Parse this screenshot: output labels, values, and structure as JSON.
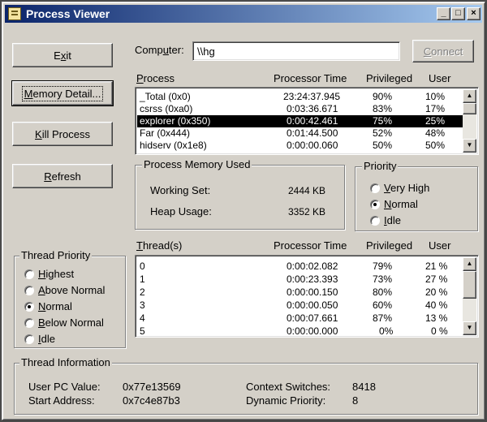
{
  "window": {
    "title": "Process Viewer"
  },
  "titlebar_buttons": {
    "minimize": "_",
    "maximize": "□",
    "close": "×"
  },
  "buttons": {
    "exit": {
      "pre": "E",
      "acc": "x",
      "post": "it"
    },
    "memory_detail": {
      "pre": "",
      "acc": "M",
      "post": "emory Detail..."
    },
    "kill_process": {
      "pre": "",
      "acc": "K",
      "post": "ill Process"
    },
    "refresh": {
      "pre": "",
      "acc": "R",
      "post": "efresh"
    },
    "connect": {
      "pre": "",
      "acc": "C",
      "post": "onnect"
    }
  },
  "computer": {
    "label_pre": "Comp",
    "label_acc": "u",
    "label_post": "ter:",
    "value": "\\\\hg"
  },
  "process_list": {
    "headers": {
      "process_acc": "P",
      "process_post": "rocess",
      "time": "Processor Time",
      "priv": "Privileged",
      "user": "User"
    },
    "rows": [
      {
        "name": "_Total (0x0)",
        "time": "23:24:37.945",
        "priv": "90%",
        "user": "10%"
      },
      {
        "name": "csrss (0xa0)",
        "time": "0:03:36.671",
        "priv": "83%",
        "user": "17%"
      },
      {
        "name": "explorer (0x350)",
        "time": "0:00:42.461",
        "priv": "75%",
        "user": "25%"
      },
      {
        "name": "Far (0x444)",
        "time": "0:01:44.500",
        "priv": "52%",
        "user": "48%"
      },
      {
        "name": "hidserv (0x1e8)",
        "time": "0:00:00.060",
        "priv": "50%",
        "user": "50%"
      }
    ]
  },
  "memory": {
    "title": "Process Memory Used",
    "working_set_label": "Working Set:",
    "working_set": "2444 KB",
    "heap_label": "Heap Usage:",
    "heap": "3352 KB"
  },
  "priority": {
    "title": "Priority",
    "options": [
      {
        "acc": "V",
        "post": "ery High",
        "checked": false
      },
      {
        "acc": "N",
        "post": "ormal",
        "checked": true
      },
      {
        "acc": "I",
        "post": "dle",
        "checked": false
      }
    ]
  },
  "thread_priority": {
    "title": "Thread Priority",
    "options": [
      {
        "pre": "",
        "acc": "H",
        "post": "ighest",
        "checked": false
      },
      {
        "pre": "",
        "acc": "A",
        "post": "bove Normal",
        "checked": false
      },
      {
        "pre": "",
        "acc": "N",
        "post": "ormal",
        "checked": true
      },
      {
        "pre": "",
        "acc": "B",
        "post": "elow Normal",
        "checked": false
      },
      {
        "pre": "",
        "acc": "I",
        "post": "dle",
        "checked": false
      }
    ]
  },
  "threads": {
    "headers": {
      "thread_acc": "T",
      "thread_post": "hread(s)",
      "time": "Processor Time",
      "priv": "Privileged",
      "user": "User"
    },
    "rows": [
      {
        "id": "0",
        "time": "0:00:02.082",
        "priv": "79%",
        "user": "21 %"
      },
      {
        "id": "1",
        "time": "0:00:23.393",
        "priv": "73%",
        "user": "27 %"
      },
      {
        "id": "2",
        "time": "0:00:00.150",
        "priv": "80%",
        "user": "20 %"
      },
      {
        "id": "3",
        "time": "0:00:00.050",
        "priv": "60%",
        "user": "40 %"
      },
      {
        "id": "4",
        "time": "0:00:07.661",
        "priv": "87%",
        "user": "13 %"
      },
      {
        "id": "5",
        "time": "0:00:00.000",
        "priv": "0%",
        "user": "0 %"
      }
    ]
  },
  "thread_info": {
    "title": "Thread Information",
    "user_pc_label": "User PC Value:",
    "user_pc": "0x77e13569",
    "start_addr_label": "Start Address:",
    "start_addr": "0x7c4e87b3",
    "ctx_label": "Context Switches:",
    "ctx": "8418",
    "dyn_label": "Dynamic Priority:",
    "dyn": "8"
  }
}
